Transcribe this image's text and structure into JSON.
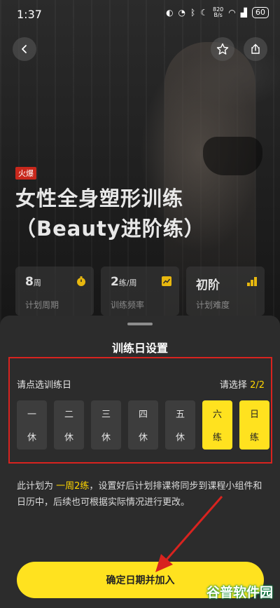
{
  "status_bar": {
    "time": "1:37",
    "net_speed_top": "820",
    "net_speed_bottom": "B/s",
    "battery": "60"
  },
  "top_actions": {
    "back_icon": "chevron-left-icon",
    "favorite_icon": "star-icon",
    "share_icon": "share-icon"
  },
  "course": {
    "badge": "火爆",
    "title_line1": "女性全身塑形训练",
    "title_line2": "（Beauty进阶练）",
    "stats": [
      {
        "value": "8",
        "unit": "周",
        "label": "计划周期",
        "icon": "stopwatch-icon"
      },
      {
        "value": "2",
        "unit": "练/周",
        "label": "训练频率",
        "icon": "trend-icon"
      },
      {
        "value": "初阶",
        "unit": "",
        "label": "计划难度",
        "icon": "level-bars-icon"
      }
    ]
  },
  "sheet": {
    "title": "训练日设置",
    "prompt": "请点选训练日",
    "select_label": "请选择",
    "select_count": "2/2",
    "days": [
      {
        "name": "一",
        "status": "休",
        "selected": false
      },
      {
        "name": "二",
        "status": "休",
        "selected": false
      },
      {
        "name": "三",
        "status": "休",
        "selected": false
      },
      {
        "name": "四",
        "status": "休",
        "selected": false
      },
      {
        "name": "五",
        "status": "休",
        "selected": false
      },
      {
        "name": "六",
        "status": "练",
        "selected": true
      },
      {
        "name": "日",
        "status": "练",
        "selected": true
      }
    ],
    "note_prefix": "此计划为 ",
    "note_highlight": "一周2练",
    "note_suffix": "，设置好后计划排课将同步到课程小组件和日历中，后续也可根据实际情况进行更改。",
    "confirm_button": "确定日期并加入"
  },
  "colors": {
    "accent": "#ffe21f",
    "hot_badge": "#c8281c",
    "annotation": "#d8231f"
  },
  "watermark": "谷普软件园"
}
